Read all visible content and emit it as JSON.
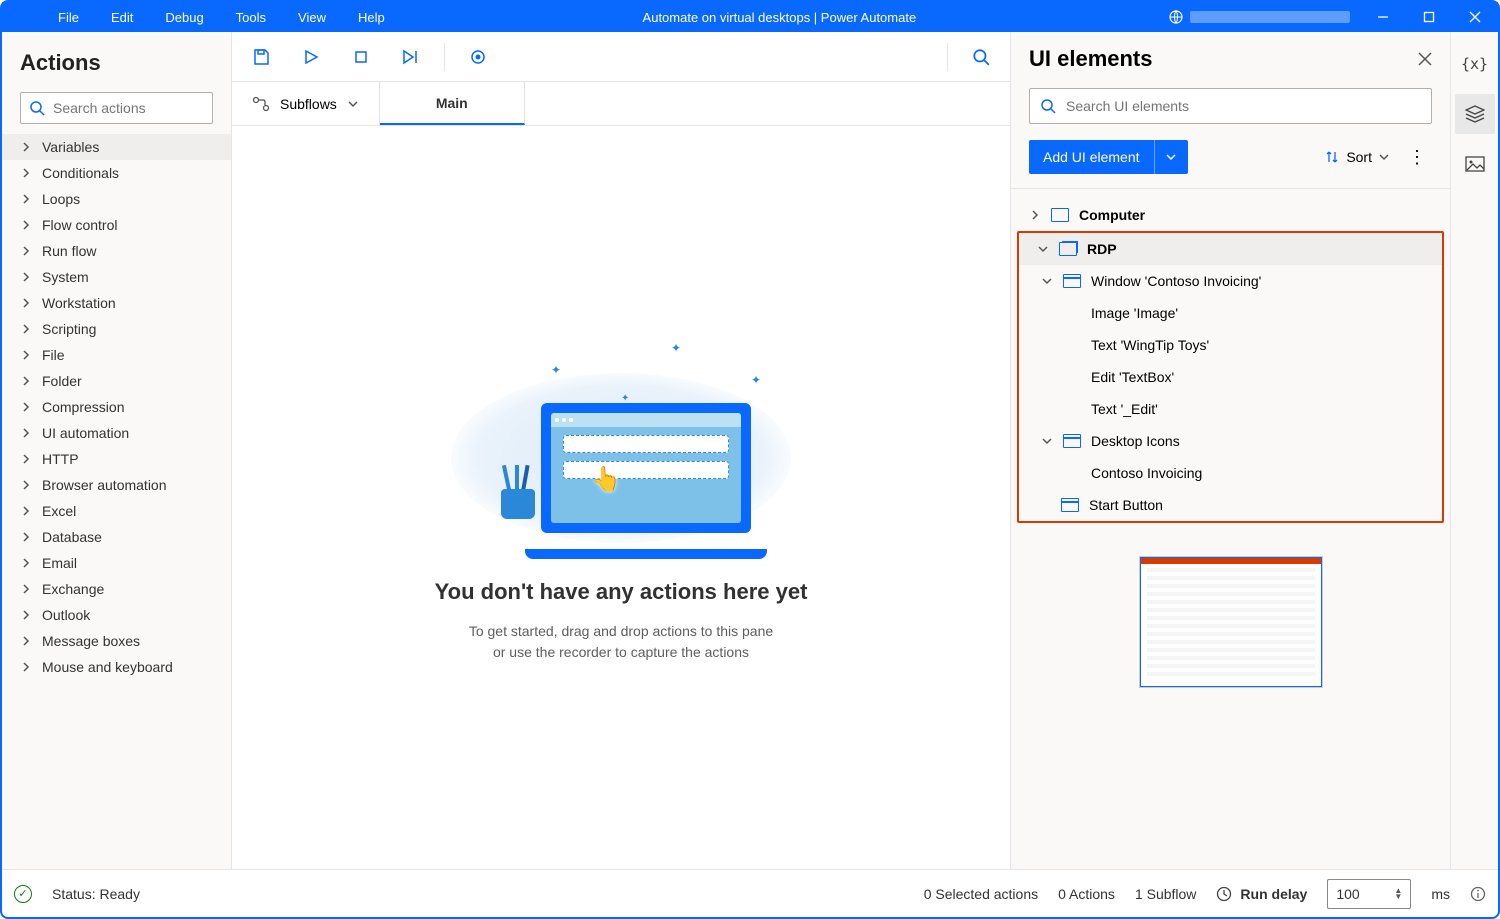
{
  "menu": {
    "file": "File",
    "edit": "Edit",
    "debug": "Debug",
    "tools": "Tools",
    "view": "View",
    "help": "Help"
  },
  "title": "Automate on virtual desktops | Power Automate",
  "actions": {
    "header": "Actions",
    "search_placeholder": "Search actions",
    "items": [
      "Variables",
      "Conditionals",
      "Loops",
      "Flow control",
      "Run flow",
      "System",
      "Workstation",
      "Scripting",
      "File",
      "Folder",
      "Compression",
      "UI automation",
      "HTTP",
      "Browser automation",
      "Excel",
      "Database",
      "Email",
      "Exchange",
      "Outlook",
      "Message boxes",
      "Mouse and keyboard"
    ]
  },
  "tabs": {
    "subflows": "Subflows",
    "main": "Main"
  },
  "empty": {
    "heading": "You don't have any actions here yet",
    "line1": "To get started, drag and drop actions to this pane",
    "line2": "or use the recorder to capture the actions"
  },
  "ui": {
    "header": "UI elements",
    "search_placeholder": "Search UI elements",
    "add": "Add UI element",
    "sort": "Sort",
    "tree": {
      "computer": "Computer",
      "rdp": "RDP",
      "window": "Window 'Contoso Invoicing'",
      "img": "Image 'Image'",
      "txt1": "Text 'WingTip Toys'",
      "edit": "Edit 'TextBox'",
      "txt2": "Text '_Edit'",
      "desktop": "Desktop Icons",
      "contoso": "Contoso Invoicing",
      "start": "Start Button"
    }
  },
  "status": {
    "ready": "Status: Ready",
    "selected": "0 Selected actions",
    "actions": "0 Actions",
    "subflows": "1 Subflow",
    "rundelay": "Run delay",
    "value": "100",
    "unit": "ms"
  }
}
